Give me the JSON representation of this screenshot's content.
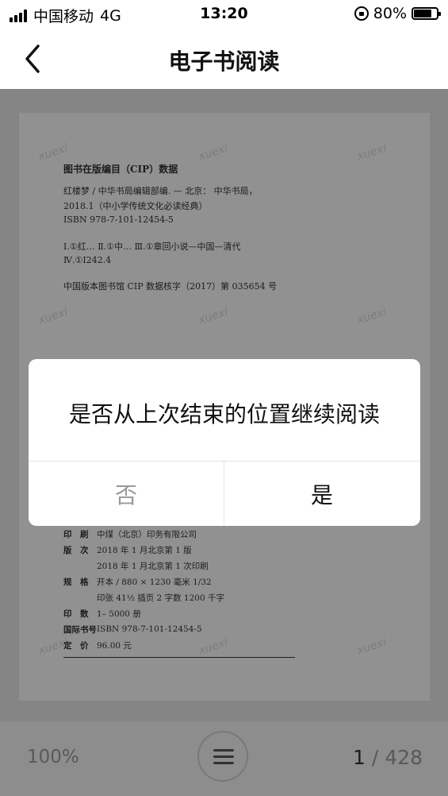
{
  "status_bar": {
    "carrier": "中国移动",
    "network": "4G",
    "time": "13:20",
    "battery": "80%",
    "battery_level": 0.8
  },
  "nav": {
    "back_icon": "chevron-left-icon",
    "title": "电子书阅读"
  },
  "page": {
    "watermark": "xuexi",
    "cip_title": "图书在版编目（CIP）数据",
    "cip_lines": [
      "红楼梦 / 中华书局编辑部编. — 北京： 中华书局，",
      "2018.1（中小学传统文化必读经典）",
      "ISBN 978-7-101-12454-5",
      "Ⅰ.①红… Ⅱ.①中… Ⅲ.①章回小说—中国—清代",
      "Ⅳ.①I242.4",
      "中国版本图书馆 CIP 数据核字（2017）第 035654 号"
    ],
    "imprint": [
      {
        "label": "印　刷",
        "value": "中煤（北京）印务有限公司"
      },
      {
        "label": "版　次",
        "value": "2018 年 1 月北京第 1 版"
      },
      {
        "label": "",
        "value": "2018 年 1 月北京第 1 次印刷"
      },
      {
        "label": "规　格",
        "value": "开本 / 880 × 1230 毫米  1/32"
      },
      {
        "label": "",
        "value": "印张 41½   插页 2   字数 1200 千字"
      },
      {
        "label": "印　数",
        "value": "1– 5000 册"
      },
      {
        "label": "国际书号",
        "value": "ISBN 978-7-101-12454-5"
      },
      {
        "label": "定　价",
        "value": "96.00 元"
      }
    ]
  },
  "dialog": {
    "message": "是否从上次结束的位置继续阅读",
    "no_label": "否",
    "yes_label": "是"
  },
  "bottom": {
    "zoom": "100%",
    "menu_icon": "menu-icon",
    "current_page": "1",
    "separator": " / ",
    "total_pages": "428"
  }
}
